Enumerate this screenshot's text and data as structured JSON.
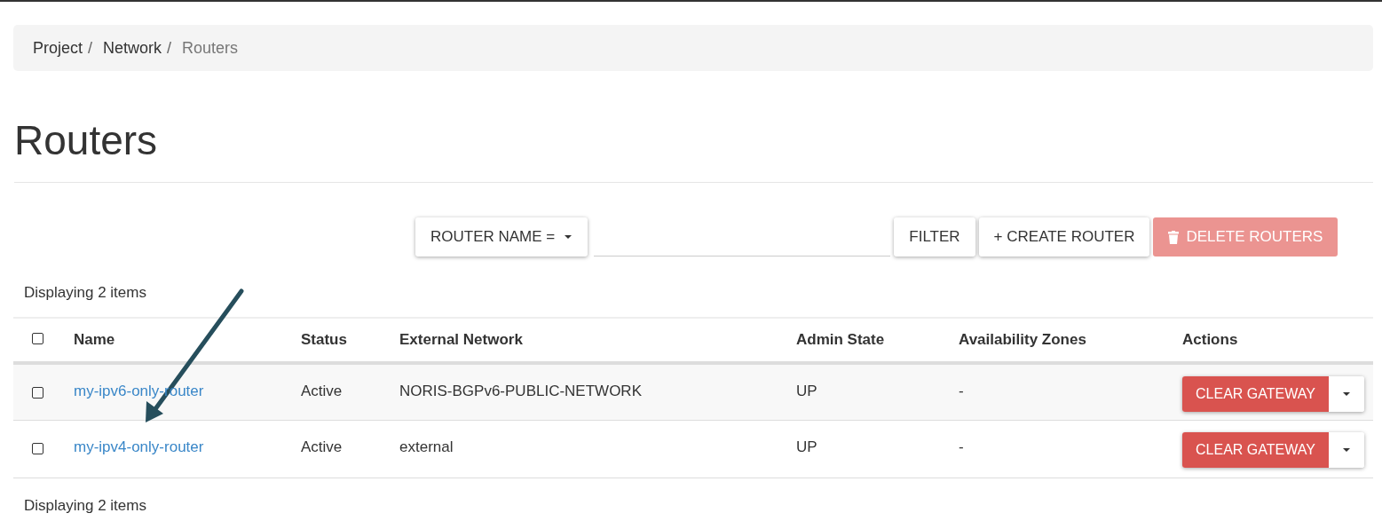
{
  "breadcrumb": [
    {
      "label": "Project",
      "current": false,
      "separator": "/"
    },
    {
      "label": "Network",
      "current": false,
      "separator": "/"
    },
    {
      "label": "Routers",
      "current": true
    }
  ],
  "title": "Routers",
  "toolbar": {
    "filter_type": "ROUTER NAME =",
    "filter_button": "FILTER",
    "create_button": "+ CREATE ROUTER",
    "delete_button": {
      "label": "DELETE ROUTERS",
      "disabled": true
    }
  },
  "count_top": "Displaying 2 items",
  "table": {
    "select_all_checked": false,
    "columns": [
      "Name",
      "Status",
      "External Network",
      "Admin State",
      "Availability Zones",
      "Actions"
    ],
    "rows": [
      {
        "checked": false,
        "name": "my-ipv6-only-router",
        "status": "Active",
        "external_network": "NORIS-BGPv6-PUBLIC-NETWORK",
        "admin_state": "UP",
        "availability_zones": "-",
        "action": "CLEAR GATEWAY"
      },
      {
        "checked": false,
        "name": "my-ipv4-only-router",
        "status": "Active",
        "external_network": "external",
        "admin_state": "UP",
        "availability_zones": "-",
        "action": "CLEAR GATEWAY"
      }
    ]
  },
  "count_bottom": "Displaying 2 items"
}
